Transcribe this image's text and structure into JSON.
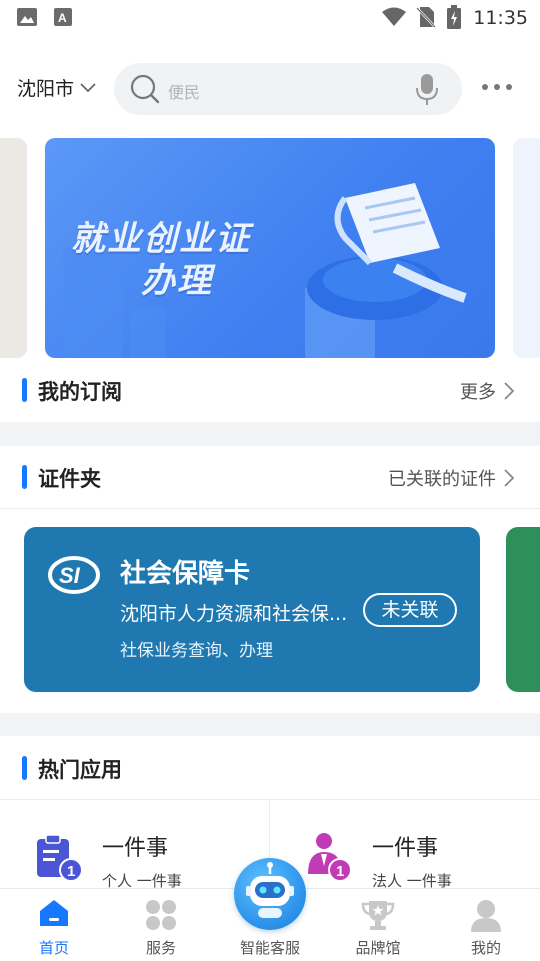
{
  "status_bar": {
    "time": "11:35"
  },
  "header": {
    "city": "沈阳市",
    "search_placeholder": "便民"
  },
  "banner": {
    "title_line1": "就业创业证",
    "title_line2": "办理"
  },
  "subscription": {
    "title": "我的订阅",
    "link": "更多"
  },
  "certificates": {
    "title": "证件夹",
    "link": "已关联的证件",
    "card": {
      "title": "社会保障卡",
      "org": "沈阳市人力资源和社会保...",
      "desc": "社保业务查询、办理",
      "status": "未关联",
      "color": "#1f78b0"
    }
  },
  "hot_apps": {
    "title": "热门应用",
    "items": [
      {
        "title": "一件事",
        "subtitle": "个人 一件事",
        "icon": "clipboard-badge-icon",
        "color": "#4a56d6"
      },
      {
        "title": "一件事",
        "subtitle": "法人 一件事",
        "icon": "person-badge-icon",
        "color": "#c23bb6"
      }
    ]
  },
  "bottom_nav": {
    "items": [
      {
        "label": "首页",
        "icon": "home-icon",
        "active": true
      },
      {
        "label": "服务",
        "icon": "grid-icon",
        "active": false
      },
      {
        "label": "智能客服",
        "icon": "robot-icon",
        "active": false
      },
      {
        "label": "品牌馆",
        "icon": "trophy-icon",
        "active": false
      },
      {
        "label": "我的",
        "icon": "user-icon",
        "active": false
      }
    ]
  },
  "accent_color": "#1677ff"
}
